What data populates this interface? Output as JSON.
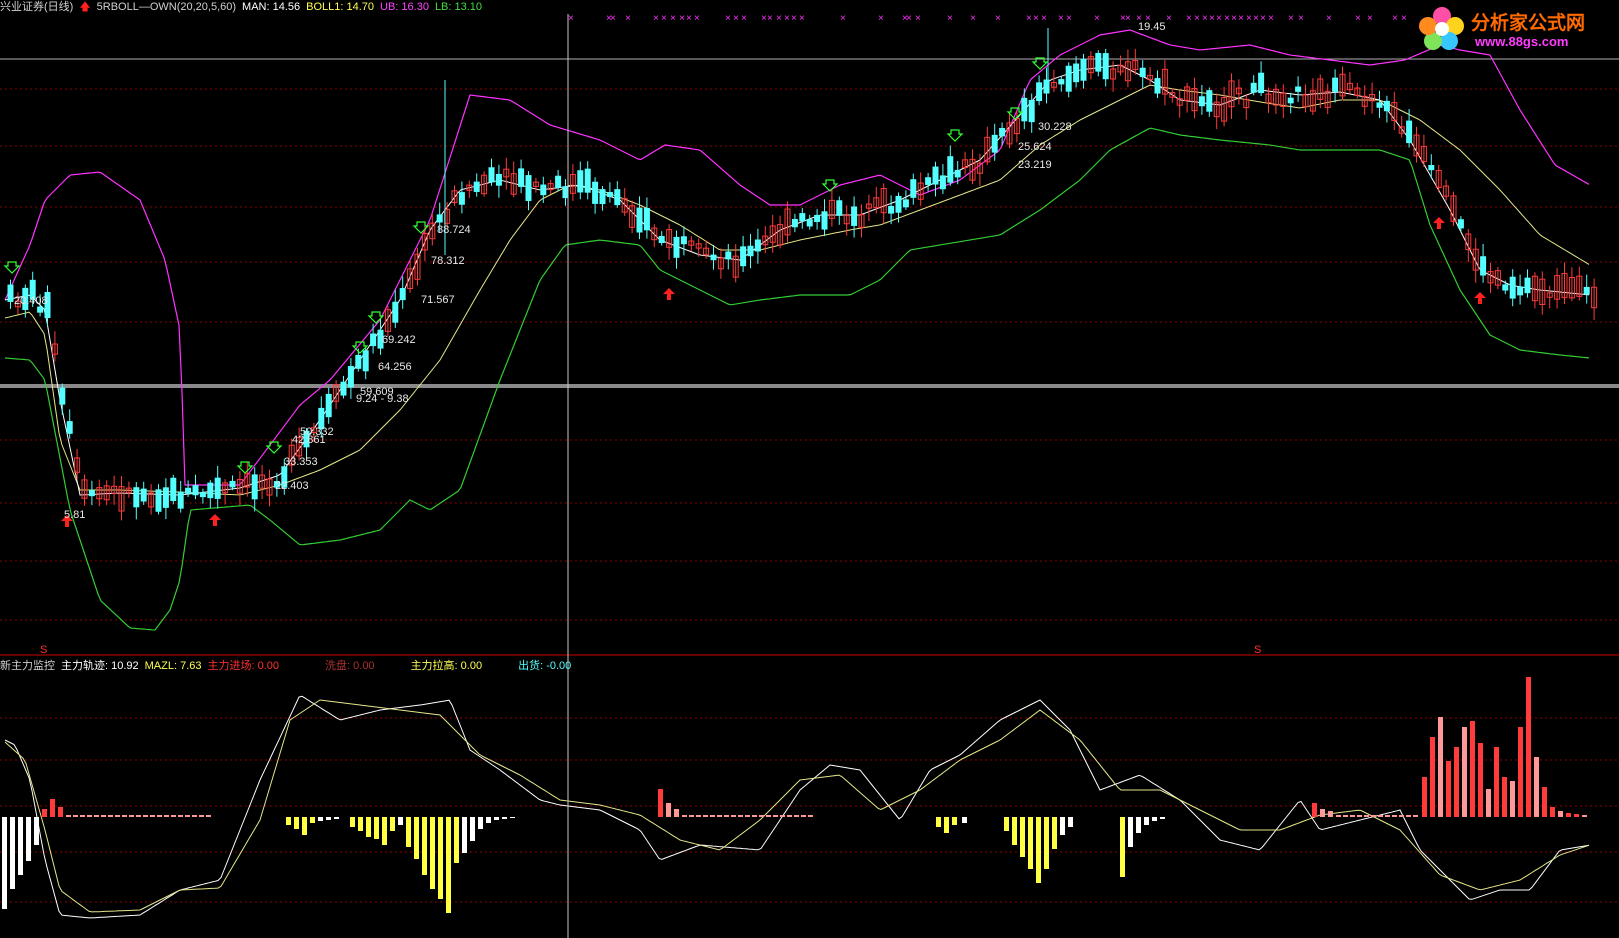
{
  "colors": {
    "up": "#ff3b3b",
    "down": "#54ffff",
    "ub": "#ff33ff",
    "lb": "#33cc33",
    "mid": "#e6e68a",
    "white": "#ffffff",
    "grid": "#8c0000",
    "yellow": "#ffff44",
    "pink": "#ff9999"
  },
  "top_header": {
    "symbol": "兴业证券(日线)",
    "indicator": "5RBOLL—OWN(20,20,5,60)",
    "man": "MAN: 14.56",
    "boll": "BOLL1: 14.70",
    "ub": "UB: 16.30",
    "lb": "LB: 13.10"
  },
  "bottom_header": {
    "name": "新主力监控",
    "track": "主力轨迹: 10.92",
    "mazl": "MAZL: 7.63",
    "enter": "主力进场: 0.00",
    "wash": "洗盘: 0.00",
    "raise": "主力拉高: 0.00",
    "ship": "出货: -0.00"
  },
  "logo": {
    "name": "分析家公式网",
    "url": "www.88gs.com"
  },
  "price_labels": [
    "20.408",
    "5.81",
    "22.403",
    "33.353",
    "42.861",
    "50.332",
    "59.609",
    "9.24 - 9.38",
    "64.256",
    "69.242",
    "71.567",
    "78.312",
    "88.724",
    "30.228",
    "25.624",
    "23.219",
    "19.45"
  ],
  "markers": {
    "s_glyph": "S",
    "cross": "×"
  },
  "chart_data": {
    "type": "candlestick",
    "note_series": "price candles with Bollinger upper/lower bands and moving averages; lower panel oscillator with histogram",
    "price_range": [
      5.5,
      20
    ],
    "close_trend": [
      5.8,
      6.2,
      6.0,
      6.1,
      6.3,
      6.4,
      6.5,
      6.4,
      6.6,
      6.8,
      7.2,
      7.9,
      8.6,
      9.3,
      9.9,
      10.6,
      11.4,
      12.2,
      13.1,
      13.8,
      14.5,
      15.2,
      15.6,
      16.0,
      16.2,
      16.5,
      17.0,
      17.6,
      18.3,
      19.0,
      19.4,
      18.8,
      18.2,
      17.9,
      17.5,
      17.2,
      16.9,
      16.4,
      15.8,
      15.3,
      14.8,
      14.6
    ],
    "lower_panel": {
      "series": [
        "主力轨迹",
        "MAZL"
      ],
      "track": 10.92,
      "mazl": 7.63
    }
  }
}
